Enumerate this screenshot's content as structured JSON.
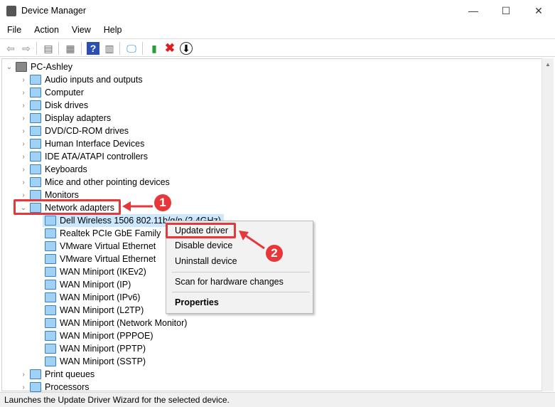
{
  "window": {
    "title": "Device Manager",
    "minimize": "—",
    "maximize": "☐",
    "close": "✕"
  },
  "menu": [
    "File",
    "Action",
    "View",
    "Help"
  ],
  "toolbar": [
    "back-icon",
    "forward-icon",
    "show-hide-console-tree-icon",
    "properties-icon",
    "help-icon",
    "action-pane-icon",
    "scan-hardware-icon",
    "update-driver-icon",
    "uninstall-icon",
    "disable-device-icon"
  ],
  "tree": {
    "root": "PC-Ashley",
    "categories": [
      "Audio inputs and outputs",
      "Computer",
      "Disk drives",
      "Display adapters",
      "DVD/CD-ROM drives",
      "Human Interface Devices",
      "IDE ATA/ATAPI controllers",
      "Keyboards",
      "Mice and other pointing devices",
      "Monitors",
      "Network adapters"
    ],
    "network_children": [
      "Dell Wireless 1506 802.11b/g/n (2.4GHz)",
      "Realtek PCIe GbE Family",
      "VMware Virtual Ethernet",
      "VMware Virtual Ethernet",
      "WAN Miniport (IKEv2)",
      "WAN Miniport (IP)",
      "WAN Miniport (IPv6)",
      "WAN Miniport (L2TP)",
      "WAN Miniport (Network Monitor)",
      "WAN Miniport (PPPOE)",
      "WAN Miniport (PPTP)",
      "WAN Miniport (SSTP)"
    ],
    "after": [
      "Print queues",
      "Processors"
    ]
  },
  "context_menu": {
    "update": "Update driver",
    "disable": "Disable device",
    "uninstall": "Uninstall device",
    "scan": "Scan for hardware changes",
    "properties": "Properties"
  },
  "annotations": {
    "step1": "1",
    "step2": "2",
    "color": "#e8373b"
  },
  "status": "Launches the Update Driver Wizard for the selected device."
}
